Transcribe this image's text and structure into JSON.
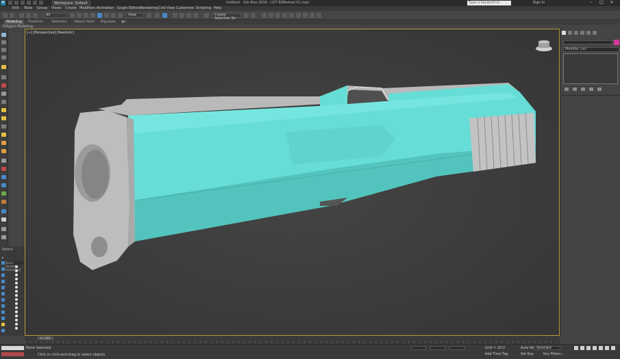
{
  "titlebar": {
    "workspace": "Workspace: Default",
    "title": "Untitled - 3ds Max 2016 - LDT EDRemod 01.max",
    "search_placeholder": "Type a keyword or phrase",
    "sign_in": "Sign In"
  },
  "menubar": {
    "items": [
      "Edit",
      "Tools",
      "Group",
      "Views",
      "Create",
      "Modifiers",
      "Animation",
      "Graph Editors",
      "Rendering",
      "Civil View",
      "Customize",
      "Scripting",
      "Help"
    ]
  },
  "toolbar": {
    "selection_filter": "All",
    "reference_coord": "View",
    "named_selection": "Create Selection Se"
  },
  "ribbon": {
    "tabs": [
      "Modeling",
      "Freeform",
      "Selection",
      "Object Paint",
      "Populate"
    ],
    "active_tab": "Modeling",
    "sub_label": "Polygon Modeling"
  },
  "viewport": {
    "label": "[+] [Perspective] [Realistic]",
    "slide_color": "#66ddd6",
    "steel_color": "#bfbfbf"
  },
  "scene_explorer": {
    "header": "Select",
    "tab_label": "Name (Sorted Ascending)"
  },
  "command_panel": {
    "modifier_list": "Modifier List",
    "color_swatch": "#d33a9a"
  },
  "timeline": {
    "frame": "0 / 100"
  },
  "statusbar": {
    "selected": "None Selected",
    "prompt": "Click or click-and-drag to select objects",
    "grid": "Grid = 10.0",
    "add_time_tag": "Add Time Tag",
    "auto_key": "Auto Key",
    "selected_dropdown": "Selected",
    "set_key": "Set Key",
    "key_filters": "Key Filters..."
  }
}
